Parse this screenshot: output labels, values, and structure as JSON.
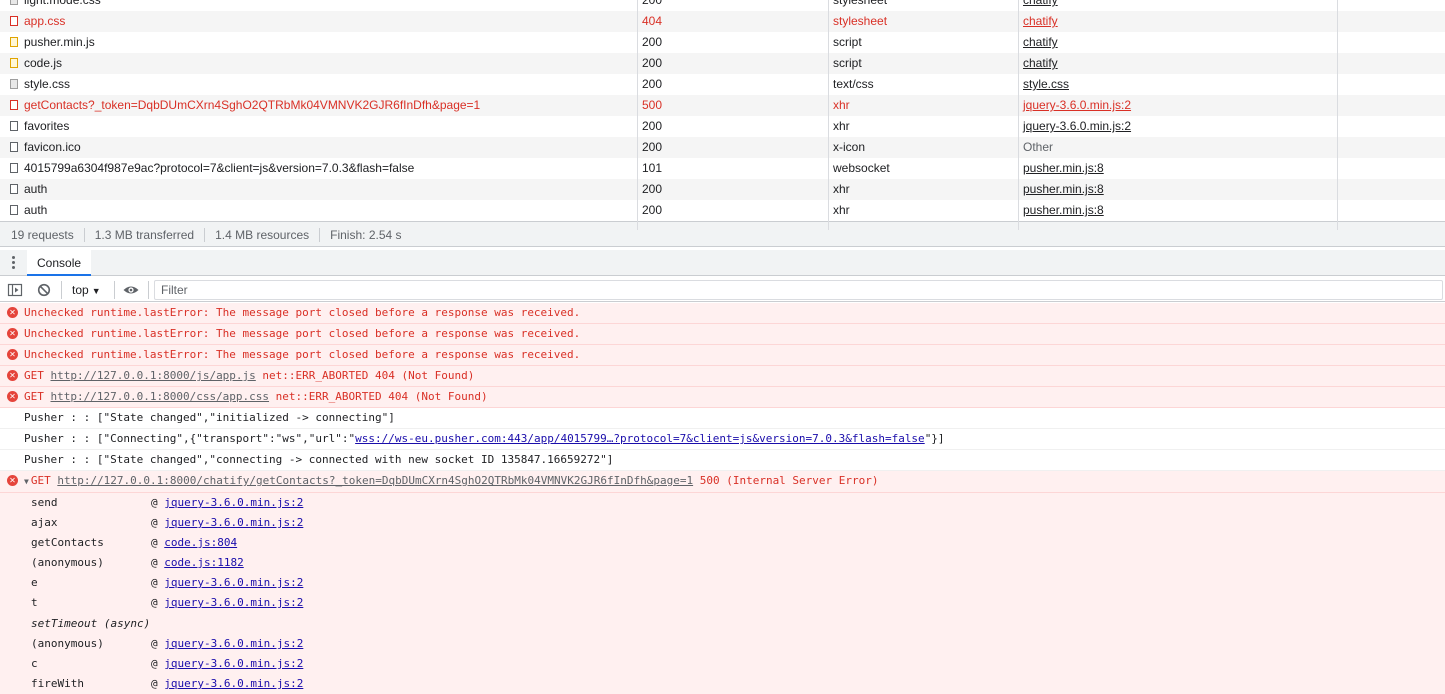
{
  "network": {
    "rows": [
      {
        "name": "light.mode.css",
        "status": "200",
        "type": "stylesheet",
        "initiator": "chatify",
        "error": false,
        "icon": "css-file-icon",
        "link": true
      },
      {
        "name": "app.css",
        "status": "404",
        "type": "stylesheet",
        "initiator": "chatify",
        "error": true,
        "icon": "css-file-icon",
        "link": true
      },
      {
        "name": "pusher.min.js",
        "status": "200",
        "type": "script",
        "initiator": "chatify",
        "error": false,
        "icon": "js-file-icon",
        "link": true
      },
      {
        "name": "code.js",
        "status": "200",
        "type": "script",
        "initiator": "chatify",
        "error": false,
        "icon": "js-file-icon",
        "link": true
      },
      {
        "name": "style.css",
        "status": "200",
        "type": "text/css",
        "initiator": "style.css",
        "error": false,
        "icon": "css-file-icon",
        "link": true
      },
      {
        "name": "getContacts?_token=DqbDUmCXrn4SghO2QTRbMk04VMNVK2GJR6fInDfh&page=1",
        "status": "500",
        "type": "xhr",
        "initiator": "jquery-3.6.0.min.js:2",
        "error": true,
        "icon": "xhr-file-icon",
        "link": true
      },
      {
        "name": "favorites",
        "status": "200",
        "type": "xhr",
        "initiator": "jquery-3.6.0.min.js:2",
        "error": false,
        "icon": "xhr-file-icon",
        "link": true
      },
      {
        "name": "favicon.ico",
        "status": "200",
        "type": "x-icon",
        "initiator": "Other",
        "error": false,
        "icon": "file-icon",
        "link": false
      },
      {
        "name": "4015799a6304f987e9ac?protocol=7&client=js&version=7.0.3&flash=false",
        "status": "101",
        "type": "websocket",
        "initiator": "pusher.min.js:8",
        "error": false,
        "icon": "file-icon",
        "link": true
      },
      {
        "name": "auth",
        "status": "200",
        "type": "xhr",
        "initiator": "pusher.min.js:8",
        "error": false,
        "icon": "xhr-file-icon",
        "link": true
      },
      {
        "name": "auth",
        "status": "200",
        "type": "xhr",
        "initiator": "pusher.min.js:8",
        "error": false,
        "icon": "xhr-file-icon",
        "link": true
      }
    ],
    "summary": {
      "requests": "19 requests",
      "transferred": "1.3 MB transferred",
      "resources": "1.4 MB resources",
      "finish": "Finish: 2.54 s"
    }
  },
  "drawer": {
    "tab_label": "Console"
  },
  "toolbar": {
    "context": "top",
    "filter_placeholder": "Filter"
  },
  "console": {
    "messages": [
      {
        "kind": "error",
        "text": "Unchecked runtime.lastError: The message port closed before a response was received."
      },
      {
        "kind": "error",
        "text": "Unchecked runtime.lastError: The message port closed before a response was received."
      },
      {
        "kind": "error",
        "text": "Unchecked runtime.lastError: The message port closed before a response was received."
      },
      {
        "kind": "error",
        "pre": "GET ",
        "link": "http://127.0.0.1:8000/js/app.js",
        "post": " net::ERR_ABORTED 404 (Not Found)"
      },
      {
        "kind": "error",
        "pre": "GET ",
        "link": "http://127.0.0.1:8000/css/app.css",
        "post": " net::ERR_ABORTED 404 (Not Found)"
      },
      {
        "kind": "log",
        "text": "Pusher :  : [\"State changed\",\"initialized -> connecting\"]"
      },
      {
        "kind": "log",
        "pre": "Pusher :  : [\"Connecting\",{\"transport\":\"ws\",\"url\":\"",
        "link": "wss://ws-eu.pusher.com:443/app/4015799…?protocol=7&client=js&version=7.0.3&flash=false",
        "post": "\"}]"
      },
      {
        "kind": "log",
        "text": "Pusher :  : [\"State changed\",\"connecting -> connected with new socket ID 135847.16659272\"]"
      },
      {
        "kind": "error-expanded",
        "pre": "GET ",
        "link": "http://127.0.0.1:8000/chatify/getContacts?_token=DqbDUmCXrn4SghO2QTRbMk04VMNVK2GJR6fInDfh&page=1",
        "post": " 500 (Internal Server Error)"
      }
    ],
    "stack": [
      {
        "fn": "send",
        "src": "jquery-3.6.0.min.js:2"
      },
      {
        "fn": "ajax",
        "src": "jquery-3.6.0.min.js:2"
      },
      {
        "fn": "getContacts",
        "src": "code.js:804"
      },
      {
        "fn": "(anonymous)",
        "src": "code.js:1182"
      },
      {
        "fn": "e",
        "src": "jquery-3.6.0.min.js:2"
      },
      {
        "fn": "t",
        "src": "jquery-3.6.0.min.js:2"
      },
      {
        "fn": "setTimeout (async)",
        "src": "",
        "async": true
      },
      {
        "fn": "(anonymous)",
        "src": "jquery-3.6.0.min.js:2"
      },
      {
        "fn": "c",
        "src": "jquery-3.6.0.min.js:2"
      },
      {
        "fn": "fireWith",
        "src": "jquery-3.6.0.min.js:2"
      }
    ]
  },
  "colors": {
    "error_text": "#d93026",
    "error_bg": "#fff0f0",
    "accent": "#1a73e8"
  }
}
